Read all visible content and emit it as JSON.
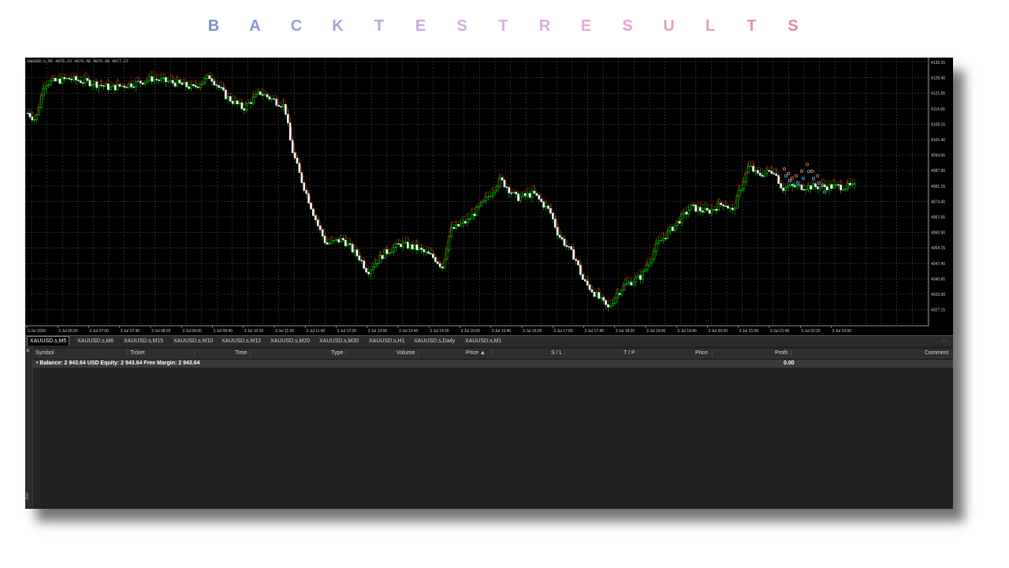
{
  "title_letters": [
    "B",
    "A",
    "C",
    "K",
    "T",
    "E",
    "S",
    "T",
    "R",
    "E",
    "S",
    "U",
    "L",
    "T",
    "S"
  ],
  "title_colors": [
    "#7d8fcc",
    "#8a97d2",
    "#96a0d6",
    "#a5a6db",
    "#b3aadf",
    "#c2ade0",
    "#d2aee0",
    "#daaddd",
    "#e2abd9",
    "#e7a8d4",
    "#eaa3cd",
    "#ec9ec4",
    "#ed97b9",
    "#ee8fae",
    "#ef84a0"
  ],
  "chart": {
    "info": "XAUUSD.s,M5  4075.23 4079.48 4076.90 4077.27",
    "price_labels": [
      "4135.15",
      "4128.40",
      "4121.65",
      "4114.90",
      "4108.15",
      "4101.40",
      "4094.65",
      "4087.90",
      "4081.15",
      "4074.40",
      "4067.65",
      "4060.90",
      "4054.15",
      "4047.40",
      "4040.65",
      "4033.90",
      "4027.15"
    ],
    "time_labels": [
      "3 Jul 2026",
      "3 Jul 06:20",
      "3 Jul 07:00",
      "3 Jul 07:40",
      "3 Jul 08:20",
      "3 Jul 09:00",
      "3 Jul 09:40",
      "3 Jul 10:20",
      "3 Jul 11:00",
      "3 Jul 11:40",
      "3 Jul 12:20",
      "3 Jul 13:00",
      "3 Jul 13:40",
      "3 Jul 14:20",
      "3 Jul 15:00",
      "3 Jul 15:40",
      "3 Jul 16:20",
      "3 Jul 17:00",
      "3 Jul 17:40",
      "3 Jul 18:20",
      "3 Jul 19:00",
      "3 Jul 19:40",
      "3 Jul 20:20",
      "3 Jul 21:00",
      "3 Jul 21:40",
      "3 Jul 22:20",
      "3 Jul 23:00"
    ],
    "colors": {
      "bull": "#00ff00",
      "bear": "#ffffff",
      "wick": "#00c800",
      "ma": "#ff2020",
      "grid": "#4a4a4a"
    }
  },
  "tabs": [
    "XAUUSD.s,M5",
    "XAUUSD.s,M6",
    "XAUUSD.s,M15",
    "XAUUSD.s,M10",
    "XAUUSD.s,M12",
    "XAUUSD.s,M20",
    "XAUUSD.s,M30",
    "XAUUSD.s,H1",
    "XAUUSD.s,Daily",
    "XAUUSD.s,M1"
  ],
  "tab_arrows": "‹ ›",
  "terminal": {
    "close": "×",
    "side_label": "Box",
    "columns": {
      "symbol": "Symbol",
      "ticket": "Ticket",
      "time": "Time",
      "type": "Type",
      "volume": "Volume",
      "price": "Price ▲",
      "sl": "S / L",
      "tp": "T / P",
      "price2": "Price",
      "profit": "Profit",
      "comment": "Comment"
    },
    "balance_row": "•  Balance: 2 943.64 USD  Equity: 2 943.64  Free Margin: 2 943.64",
    "profit_total": "0.00"
  }
}
